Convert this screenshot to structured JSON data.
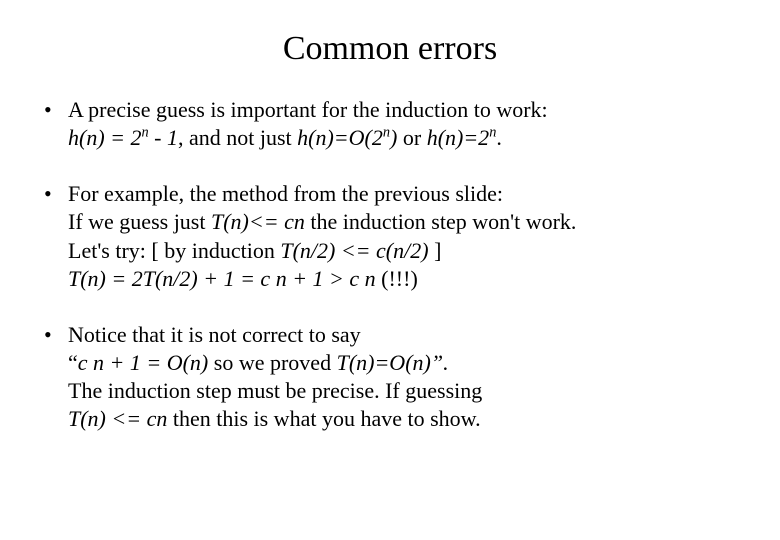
{
  "title": "Common errors",
  "bullets": [
    {
      "line1_a": "A precise guess is important for the induction to work:",
      "line2_hn": "h(n) = 2",
      "line2_exp1": "n",
      "line2_b": " - 1",
      "line2_c": ", and not just ",
      "line2_d": "h(n)=O(2",
      "line2_exp2": "n",
      "line2_e": ")",
      "line2_f": " or ",
      "line2_g": "h(n)=2",
      "line2_exp3": "n",
      "line2_h": "."
    },
    {
      "line1": "For example, the method from the previous slide:",
      "line2_a": "If we guess just ",
      "line2_b": "T(n)<= cn",
      "line2_c": " the induction step won't work.",
      "line3_a": "Let's try:  [ by induction ",
      "line3_b": "T(n/2) <= c(n/2)",
      "line3_c": " ]",
      "line4_a": "T(n) = 2T(n/2) + 1 = c n + 1 > c n",
      "line4_b": "  (!!!)"
    },
    {
      "line1": "Notice that it is not correct to say",
      "line2_a": "“",
      "line2_b": "c n + 1 = O(n)",
      "line2_c": " so we proved ",
      "line2_d": "T(n)=O(n)”.",
      "line3": "The induction step must be precise. If guessing",
      "line4_a": "T(n) <= cn",
      "line4_b": " then this is what you have to show."
    }
  ]
}
